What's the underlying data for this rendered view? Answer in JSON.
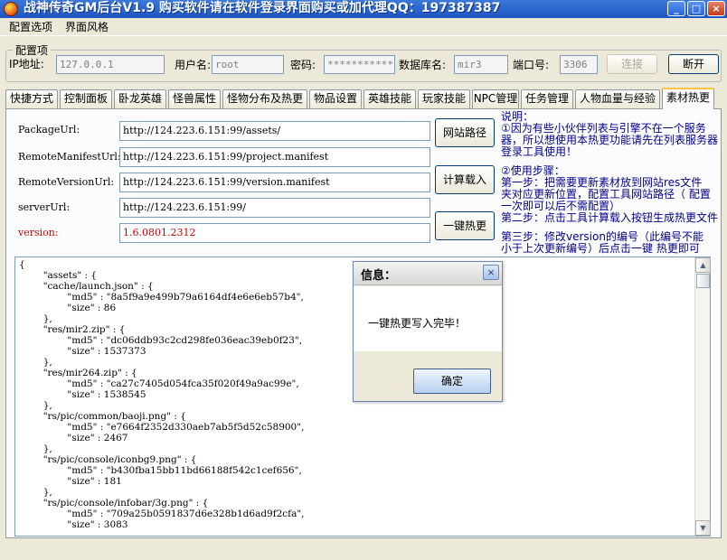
{
  "window": {
    "title": "战神传奇GM后台V1.9   购买软件请在软件登录界面购买或加代理QQ：197387387",
    "controls": {
      "minimize": "_",
      "maximize": "□",
      "close": "×"
    }
  },
  "menu": {
    "items": [
      "配置选项",
      "界面风格"
    ]
  },
  "config": {
    "legend": "配置项",
    "ip_label": "IP地址:",
    "ip_value": "127.0.0.1",
    "user_label": "用户名:",
    "user_value": "root",
    "password_label": "密码:",
    "password_value": "*************",
    "db_label": "数据库名:",
    "db_value": "mir3",
    "port_label": "端口号:",
    "port_value": "3306",
    "connect_label": "连接",
    "disconnect_label": "断开"
  },
  "tabs": [
    "快捷方式",
    "控制面板",
    "卧龙英雄",
    "怪兽属性",
    "怪物分布及热更",
    "物品设置",
    "英雄技能",
    "玩家技能",
    "NPC管理",
    "任务管理",
    "人物血量与经验",
    "素材热更"
  ],
  "active_tab": "素材热更",
  "form": {
    "package_label": "PackageUrl:",
    "package_value": "http://124.223.6.151:99/assets/",
    "remote_manifest_label": "RemoteManifestUrl:",
    "remote_manifest_value": "http://124.223.6.151:99/project.manifest",
    "remote_version_label": "RemoteVersionUrl:",
    "remote_version_value": "http://124.223.6.151:99/version.manifest",
    "server_label": "serverUrl:",
    "server_value": "http://124.223.6.151:99/",
    "version_label": "version:",
    "version_value": "1.6.0801.2312",
    "btn_site_path": "网站路径",
    "btn_calc_load": "计算载入",
    "btn_hot_update": "一键热更"
  },
  "notes": {
    "lines": [
      "说明：",
      "①因为有些小伙伴列表与引擎不在一个服务",
      "器，所以想使用本热更功能请先在列表服务器",
      "登录工具使用！",
      "",
      "②使用步骤：",
      "    第一步：把需要更新素材放到网站res文件",
      "夹对应更新位置，配置工具网站路径（  配置",
      "一次即可以后不需配置）",
      "    第二步：点击工具计算载入按钮生成热更文件",
      "",
      "    第三步：修改version的编号（此编号不能",
      "小于上次更新编号）后点击一键  热更即可"
    ]
  },
  "json_text": "{\n        \"assets\" : {\n        \"cache/launch.json\" : {\n                \"md5\" : \"8a5f9a9e499b79a6164df4e6e6eb57b4\",\n                \"size\" : 86\n        },\n        \"res/mir2.zip\" : {\n                \"md5\" : \"dc06ddb93c2cd298fe036eac39eb0f23\",\n                \"size\" : 1537373\n        },\n        \"res/mir264.zip\" : {\n                \"md5\" : \"ca27c7405d054fca35f020f49a9ac99e\",\n                \"size\" : 1538545\n        },\n        \"rs/pic/common/baoji.png\" : {\n                \"md5\" : \"e7664f2352d330aeb7ab5f5d52c58900\",\n                \"size\" : 2467\n        },\n        \"rs/pic/console/iconbg9.png\" : {\n                \"md5\" : \"b430fba15bb11bd66188f542c1cef656\",\n                \"size\" : 181\n        },\n        \"rs/pic/console/infobar/3g.png\" : {\n                \"md5\" : \"709a25b0591837d6e328b1d6ad9f2cfa\",\n                \"size\" : 3083",
  "dialog": {
    "title": "信息：",
    "message": "一键热更写入完毕！",
    "ok_label": "确定",
    "close": "×"
  },
  "colors": {
    "titlebar": "#1f54c4",
    "version_label": "#cc0000",
    "notes_text": "#00008b"
  },
  "icons": {
    "app": "app-logo-icon",
    "scroll_up": "scroll-up-icon",
    "scroll_down": "scroll-down-icon"
  }
}
